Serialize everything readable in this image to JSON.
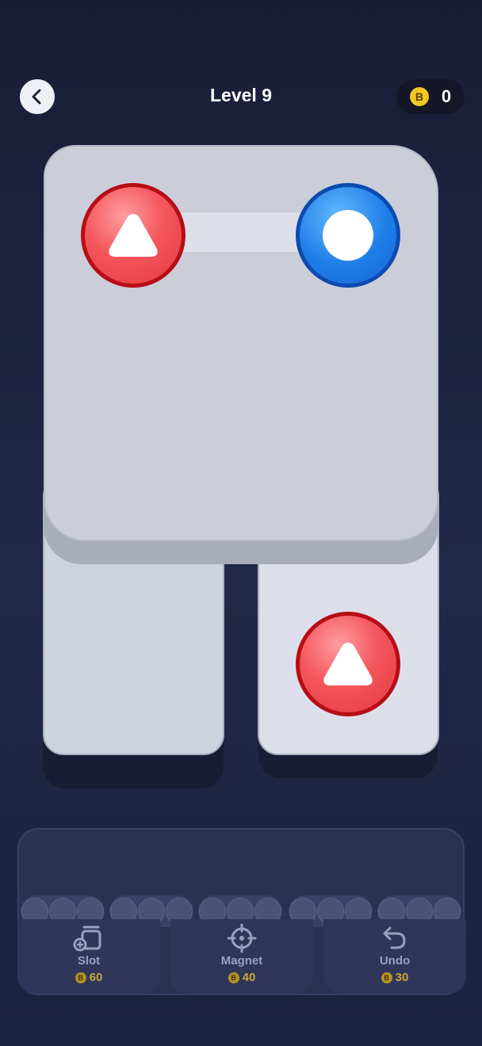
{
  "header": {
    "title": "Level 9",
    "coin_symbol": "B",
    "coin_count": "0"
  },
  "board": {
    "pieces": [
      {
        "color": "red",
        "shape": "triangle"
      },
      {
        "color": "blue",
        "shape": "circle"
      },
      {
        "color": "red",
        "shape": "triangle"
      }
    ]
  },
  "boosters": [
    {
      "label": "Slot",
      "cost": "60",
      "icon": "add-slot-icon"
    },
    {
      "label": "Magnet",
      "cost": "40",
      "icon": "crosshair-icon"
    },
    {
      "label": "Undo",
      "cost": "30",
      "icon": "undo-arrow-icon"
    }
  ],
  "colors": {
    "red_piece": "#e43a41",
    "blue_piece": "#1f7de8",
    "coin": "#f3c623",
    "cost_text": "#c8a633"
  }
}
